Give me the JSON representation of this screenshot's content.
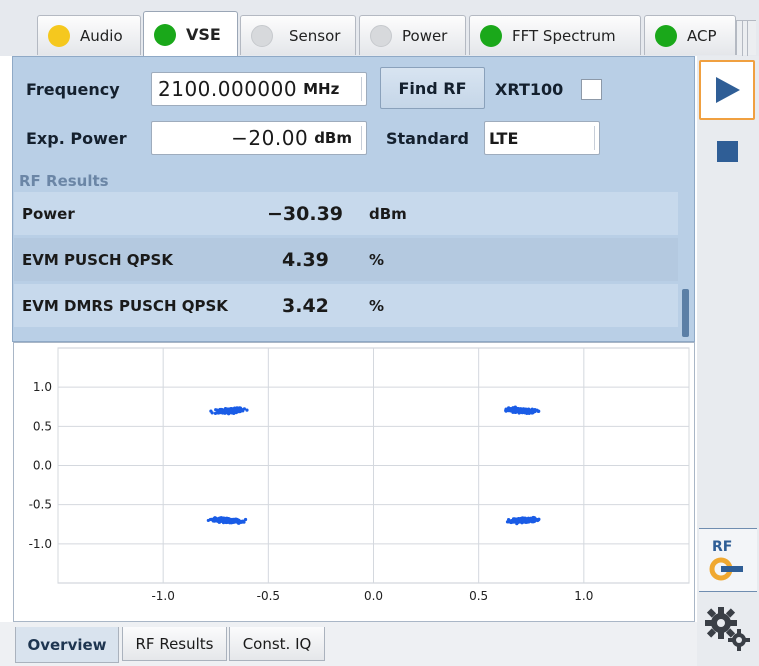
{
  "tabs": [
    {
      "label": "Audio",
      "status_color": "#f5c81e"
    },
    {
      "label": "VSE",
      "status_color": "#1aa81a"
    },
    {
      "label": "Sensor",
      "status_color": "#d7d9dc"
    },
    {
      "label": "Power",
      "status_color": "#d7d9dc"
    },
    {
      "label": "FFT Spectrum",
      "status_color": "#1aa81a"
    },
    {
      "label": "ACP",
      "status_color": "#1aa81a"
    }
  ],
  "active_tab": "VSE",
  "settings": {
    "frequency_label": "Frequency",
    "frequency_value": "2100.000000",
    "frequency_unit": "MHz",
    "find_rf_label": "Find RF",
    "xrt_label": "XRT100",
    "xrt_checked": false,
    "exp_power_label": "Exp. Power",
    "exp_power_value": "−20.00",
    "exp_power_unit": "dBm",
    "standard_label": "Standard",
    "standard_value": "LTE"
  },
  "results": {
    "title": "RF Results",
    "rows": [
      {
        "name": "Power",
        "value": "−30.39",
        "unit": "dBm"
      },
      {
        "name": "EVM PUSCH QPSK",
        "value": "4.39",
        "unit": "%"
      },
      {
        "name": "EVM DMRS PUSCH QPSK",
        "value": "3.42",
        "unit": "%"
      }
    ]
  },
  "toolbar": {
    "play_icon": "play-icon",
    "stop_icon": "stop-icon",
    "rf_label": "RF",
    "settings_icon": "gears-icon"
  },
  "chart_data": {
    "type": "scatter",
    "title": "",
    "xlabel": "",
    "ylabel": "",
    "xlim": [
      -1.5,
      1.5
    ],
    "ylim": [
      -1.5,
      1.5
    ],
    "x_ticks": [
      "-1.0",
      "-0.5",
      "0.0",
      "0.5",
      "1.0"
    ],
    "y_ticks": [
      "1.0",
      "0.5",
      "0.0",
      "-0.5",
      "-1.0"
    ],
    "grid": true,
    "color": "#1a5ce6",
    "clusters": [
      {
        "x": -0.68,
        "y": 0.7
      },
      {
        "x": 0.71,
        "y": 0.7
      },
      {
        "x": -0.7,
        "y": -0.7
      },
      {
        "x": 0.71,
        "y": -0.7
      }
    ]
  },
  "bottom_tabs": [
    "Overview",
    "RF Results",
    "Const. IQ"
  ],
  "active_bottom_tab": "Overview"
}
